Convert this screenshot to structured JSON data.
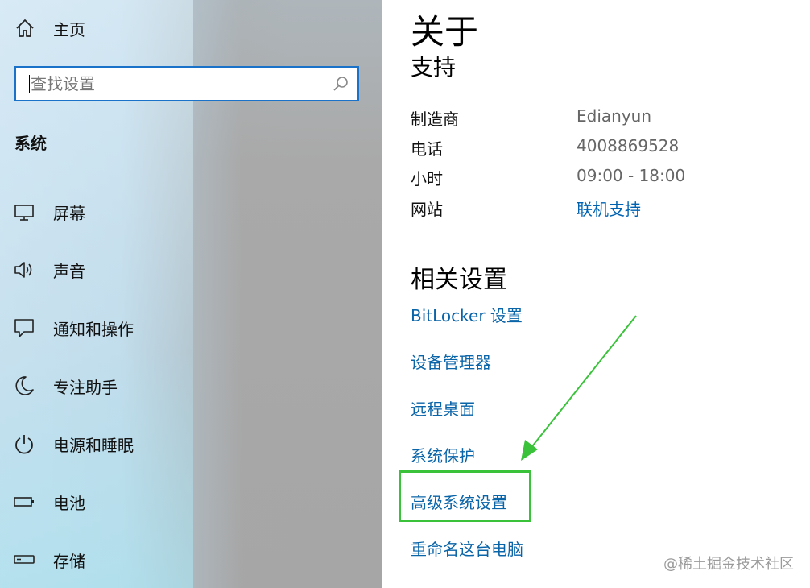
{
  "sidebar": {
    "home_label": "主页",
    "search_placeholder": "查找设置",
    "section_title": "系统",
    "items": [
      {
        "label": "屏幕",
        "icon": "monitor-icon"
      },
      {
        "label": "声音",
        "icon": "speaker-icon"
      },
      {
        "label": "通知和操作",
        "icon": "notification-icon"
      },
      {
        "label": "专注助手",
        "icon": "moon-icon"
      },
      {
        "label": "电源和睡眠",
        "icon": "power-icon"
      },
      {
        "label": "电池",
        "icon": "battery-icon"
      },
      {
        "label": "存储",
        "icon": "storage-icon"
      }
    ]
  },
  "main": {
    "title": "关于",
    "support_title": "支持",
    "support": {
      "manufacturer_label": "制造商",
      "manufacturer_value": "Edianyun",
      "phone_label": "电话",
      "phone_value": "4008869528",
      "hours_label": "小时",
      "hours_value": "09:00 - 18:00",
      "website_label": "网站",
      "website_link": "联机支持"
    },
    "related_title": "相关设置",
    "related_links": [
      "BitLocker 设置",
      "设备管理器",
      "远程桌面",
      "系统保护",
      "高级系统设置",
      "重命名这台电脑"
    ]
  },
  "annotation": {
    "highlight_color": "#39c23a"
  },
  "watermark": "@稀土掘金技术社区"
}
